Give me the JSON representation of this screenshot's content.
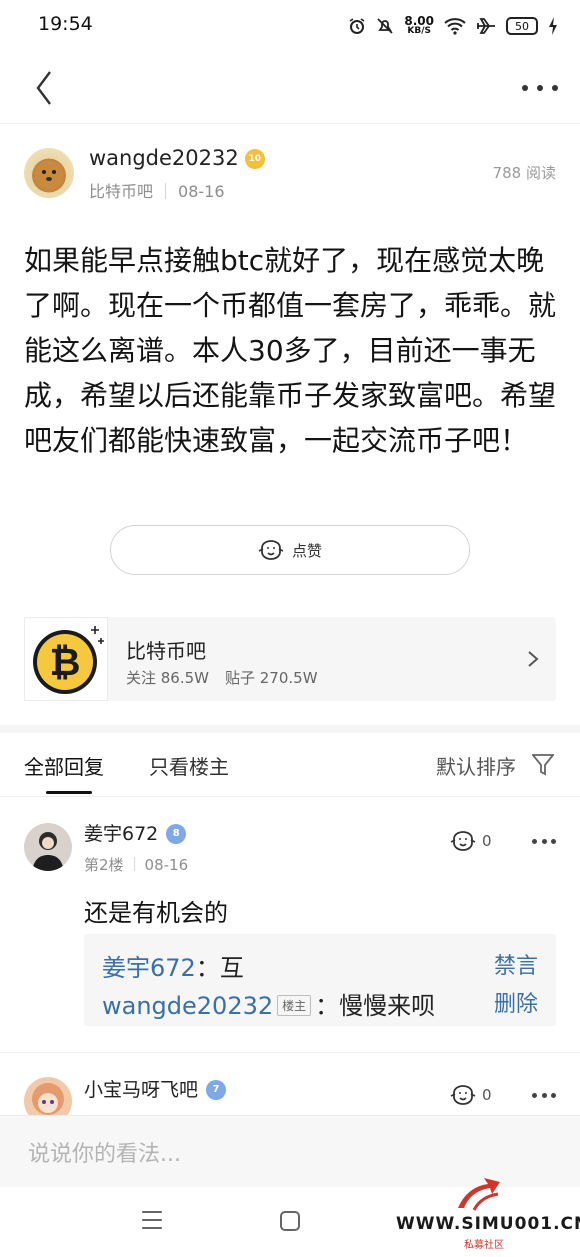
{
  "status_bar": {
    "time": "19:54",
    "net_speed_value": "8.00",
    "net_speed_unit": "KB/S",
    "battery": "50",
    "icons": [
      "alarm-icon",
      "mute-icon",
      "wifi-icon",
      "airplane-icon",
      "charging-icon"
    ]
  },
  "nav": {
    "back_icon": "chevron-left-icon",
    "more_icon": "more-dots-icon"
  },
  "post": {
    "author": "wangde20232",
    "level": "10",
    "forum": "比特币吧",
    "date": "08-16",
    "reads": "788 阅读",
    "content": "如果能早点接触btc就好了，现在感觉太晚了啊。现在一个币都值一套房了，乖乖。就能这么离谱。本人30多了，目前还一事无成，希望以后还能靠币子发家致富吧。希望吧友们都能快速致富，一起交流币子吧！",
    "like_label": "点赞"
  },
  "forum_card": {
    "name": "比特币吧",
    "followers": "关注 86.5W",
    "posts": "贴子 270.5W"
  },
  "tabs": {
    "all": "全部回复",
    "owner_only": "只看楼主",
    "sort": "默认排序"
  },
  "replies": [
    {
      "name": "姜宇672",
      "level": "8",
      "floor": "第2楼",
      "date": "08-16",
      "likes": "0",
      "text": "还是有机会的",
      "sub_replies": [
        {
          "user": "姜宇672",
          "owner_tag": "",
          "text": "互",
          "action": "禁言"
        },
        {
          "user": "wangde20232",
          "owner_tag": "楼主",
          "text": "慢慢来呗",
          "action": "删除"
        }
      ]
    },
    {
      "name": "小宝马呀飞吧",
      "level": "7",
      "likes": "0"
    }
  ],
  "input": {
    "placeholder": "说说你的看法..."
  },
  "watermark": {
    "site": "WWW.SIMU001.CN",
    "sub": "私募社区"
  }
}
